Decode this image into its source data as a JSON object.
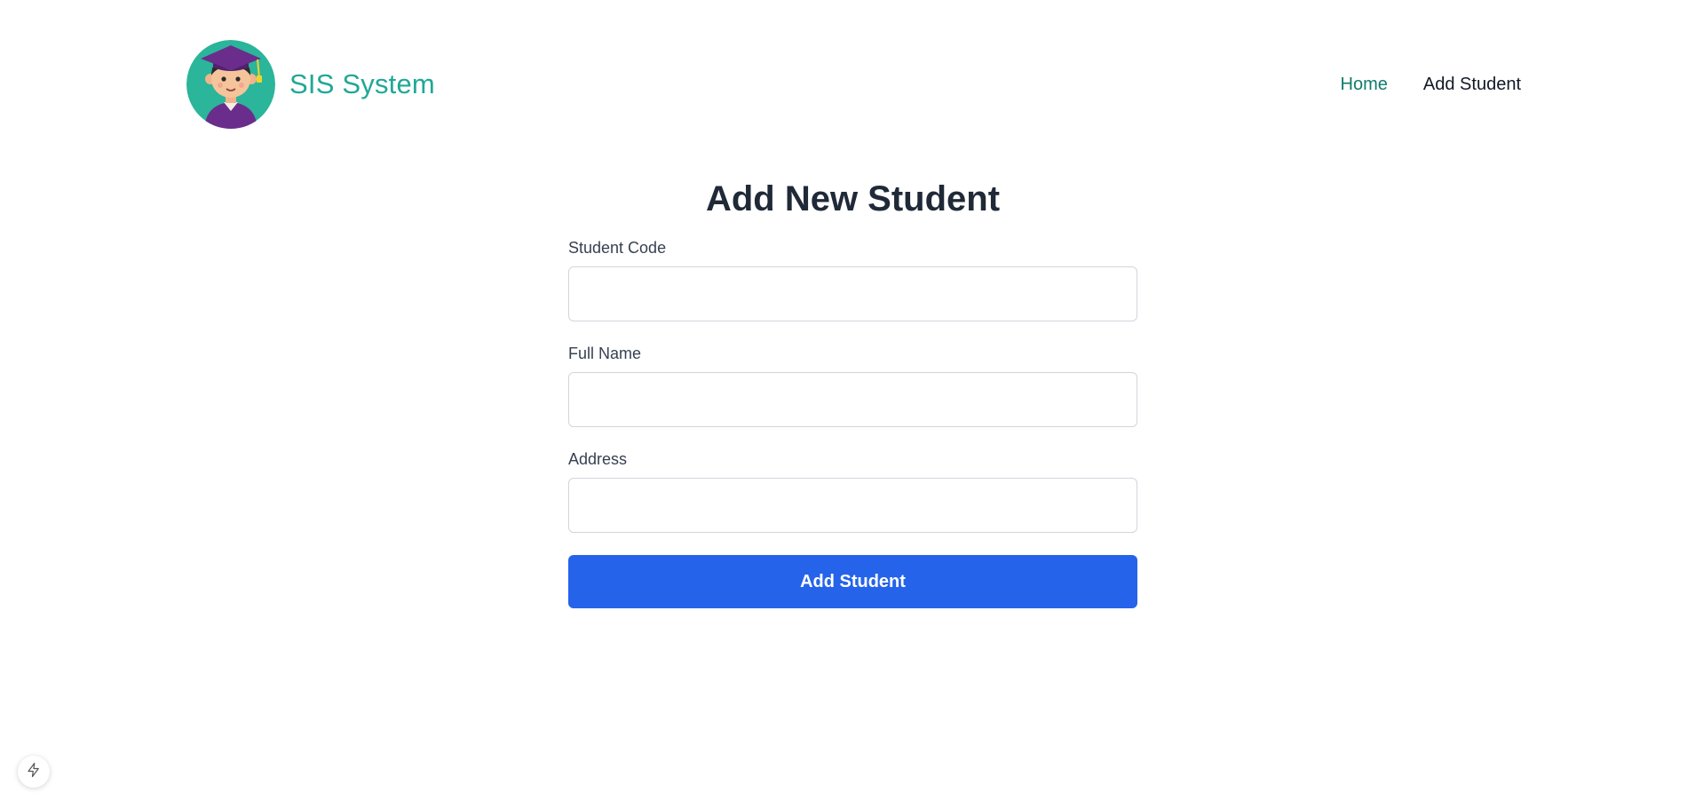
{
  "header": {
    "brand_name": "SIS System",
    "logo_icon": "graduate-student-avatar-icon",
    "nav": [
      {
        "label": "Home",
        "active": true
      },
      {
        "label": "Add Student",
        "active": false
      }
    ]
  },
  "form": {
    "title": "Add New Student",
    "fields": [
      {
        "label": "Student Code",
        "value": "",
        "placeholder": ""
      },
      {
        "label": "Full Name",
        "value": "",
        "placeholder": ""
      },
      {
        "label": "Address",
        "value": "",
        "placeholder": ""
      }
    ],
    "submit_label": "Add Student"
  },
  "floating_button": {
    "icon": "lightning-bolt-icon"
  },
  "colors": {
    "brand": "#20a896",
    "nav_active": "#0f7c6c",
    "primary_button": "#2563eb",
    "title_text": "#1f2937"
  }
}
